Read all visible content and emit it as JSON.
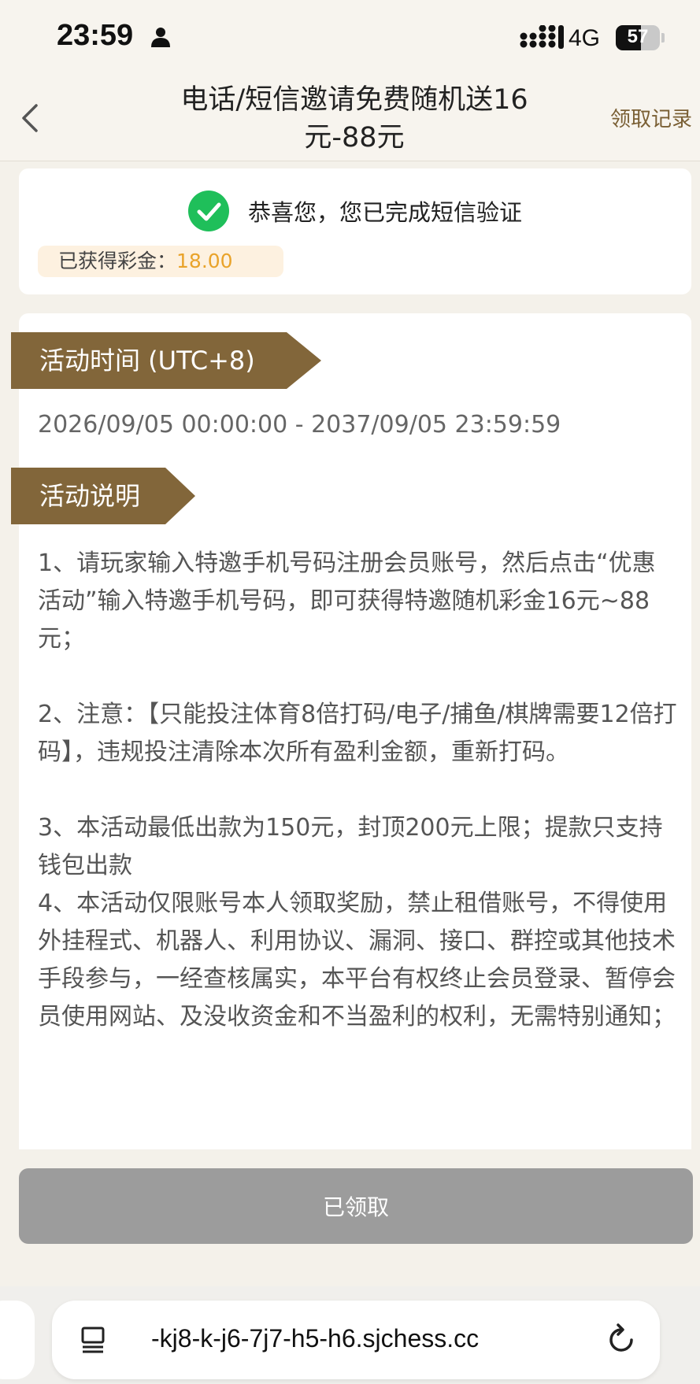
{
  "status_bar": {
    "time": "23:59",
    "network": "4G",
    "battery_level": 57,
    "battery_text": "57"
  },
  "nav": {
    "title": "电话/短信邀请免费随机送16元-88元",
    "record_link": "领取记录"
  },
  "success_card": {
    "message": "恭喜您，您已完成短信验证",
    "bonus_label": "已获得彩金：",
    "bonus_value": "18.00"
  },
  "activity": {
    "time_heading": "活动时间 (UTC+8)",
    "time_range": "2026/09/05 00:00:00 - 2037/09/05 23:59:59",
    "desc_heading": "活动说明",
    "rules": [
      "1、请玩家输入特邀手机号码注册会员账号，然后点击“优惠活动”输入特邀手机号码，即可获得特邀随机彩金16元~88元；",
      "2、注意：【只能投注体育8倍打码/电子/捕鱼/棋牌需要12倍打码】，违规投注清除本次所有盈利金额，重新打码。",
      "3、本活动最低出款为150元，封顶200元上限；提款只支持钱包出款",
      "4、本活动仅限账号本人领取奖励，禁止租借账号，不得使用外挂程式、机器人、利用协议、漏洞、接口、群控或其他技术手段参与，一经查核属实，本平台有权终止会员登录、暂停会员使用网站、及没收资金和不当盈利的权利，无需特别通知；"
    ]
  },
  "claim_button": "已领取",
  "browser": {
    "url": "-kj8-k-j6-7j7-h5-h6.sjchess.cc"
  },
  "colors": {
    "accent_brown": "#82663a",
    "success_green": "#1fbf5a",
    "bonus_orange": "#e9a32a",
    "disabled_gray": "#9c9c9c"
  },
  "icons": [
    "person-icon",
    "signal-icon",
    "back-icon",
    "check-icon",
    "page-icon",
    "reload-icon"
  ]
}
